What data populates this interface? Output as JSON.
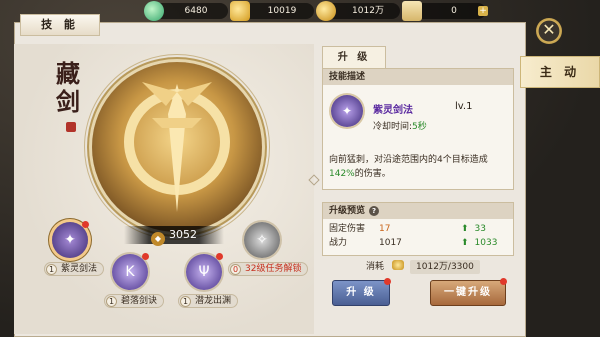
{
  "currencies": [
    {
      "icon": "jade-icon",
      "value": "6480"
    },
    {
      "icon": "gold-ingot-icon",
      "value": "10019"
    },
    {
      "icon": "coin-icon",
      "value": "1012万"
    },
    {
      "icon": "scroll-icon",
      "value": "0"
    }
  ],
  "panel": {
    "title": "技 能",
    "side_tab": "主 动"
  },
  "art": {
    "skill_set_title": "藏剑",
    "power": "3052"
  },
  "skills": [
    {
      "level": "1",
      "name": "紫灵剑法"
    },
    {
      "level": "1",
      "name": "碧落剑诀"
    },
    {
      "level": "1",
      "name": "潜龙出渊"
    },
    {
      "level": "0",
      "name": "32级任务解锁"
    }
  ],
  "detail": {
    "tab_label": "升 级",
    "desc_header": "技能描述",
    "skill_name": "紫灵剑法",
    "skill_level": "lv.1",
    "cooldown_label": "冷却时间:",
    "cooldown_value": "5秒",
    "desc_part1": "向前猛刺，对沿途范围内的4个目标造成",
    "desc_highlight": "142%",
    "desc_part2": "的伤害。",
    "preview_header": "升级预览",
    "help": "?",
    "rows": [
      {
        "label": "固定伤害",
        "current": "17",
        "next": "33"
      },
      {
        "label": "战力",
        "current": "1017",
        "next": "1033"
      }
    ],
    "cost_label": "消耗",
    "cost_value": "1012万/3300",
    "btn_upgrade": "升 级",
    "btn_one_key": "一键升级"
  }
}
